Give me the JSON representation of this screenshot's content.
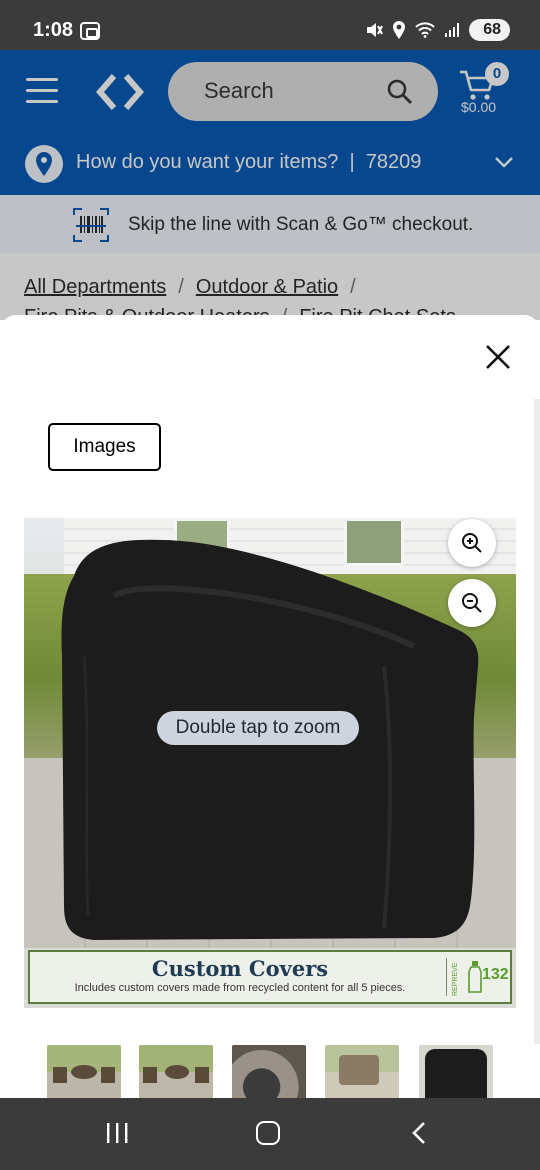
{
  "status_bar": {
    "time": "1:08",
    "battery": "68",
    "icons": [
      "screenshot-icon",
      "mute-icon",
      "location-icon",
      "wifi-icon",
      "signal-icon",
      "battery-icon"
    ]
  },
  "header": {
    "search_placeholder": "Search",
    "cart_count": "0",
    "cart_total": "$0.00",
    "location_prompt": "How do you want your items?",
    "location_separator": "|",
    "zip": "78209",
    "brand_color": "#0a5bb5"
  },
  "scan_banner": {
    "text": "Skip the line with Scan & Go™ checkout."
  },
  "breadcrumb": {
    "items": [
      "All Departments",
      "Outdoor & Patio",
      "Fire Pits & Outdoor Heaters",
      "Fire Pit Chat Sets"
    ],
    "separator": "/"
  },
  "modal": {
    "tab_images": "Images",
    "image": {
      "banner_title": "Custom Covers",
      "banner_subtitle": "Includes custom covers made from recycled content for all 5 pieces.",
      "banner_brand": "REPREVE",
      "banner_count": "132"
    },
    "tap_hint": "Double tap to zoom",
    "thumbnail_count": 5
  }
}
